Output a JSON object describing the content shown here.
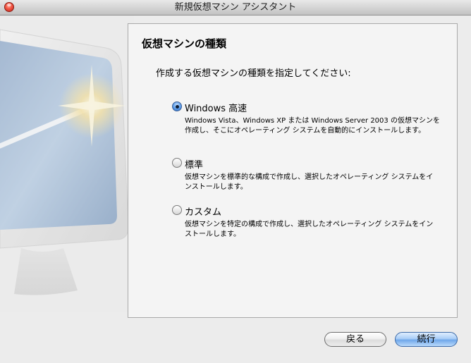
{
  "window": {
    "title": "新規仮想マシン アシスタント"
  },
  "content": {
    "heading": "仮想マシンの種類",
    "prompt": "作成する仮想マシンの種類を指定してください:"
  },
  "options": [
    {
      "label": "Windows 高速",
      "description": "Windows Vista、Windows XP または Windows Server 2003 の仮想マシンを作成し、そこにオペレーティング システムを自動的にインストールします。",
      "selected": true
    },
    {
      "label": "標準",
      "description": "仮想マシンを標準的な構成で作成し、選択したオペレーティング システムをインストールします。",
      "selected": false
    },
    {
      "label": "カスタム",
      "description": "仮想マシンを特定の構成で作成し、選択したオペレーティング システムをインストールします。",
      "selected": false
    }
  ],
  "buttons": {
    "back_label": "戻る",
    "continue_label": "続行"
  },
  "colors": {
    "accent": "#5b9be8",
    "close": "#f45a47"
  },
  "icons": {
    "close": "close-icon",
    "radio": "radio-button-icon",
    "illustration": "magic-wand-monitor-icon"
  }
}
